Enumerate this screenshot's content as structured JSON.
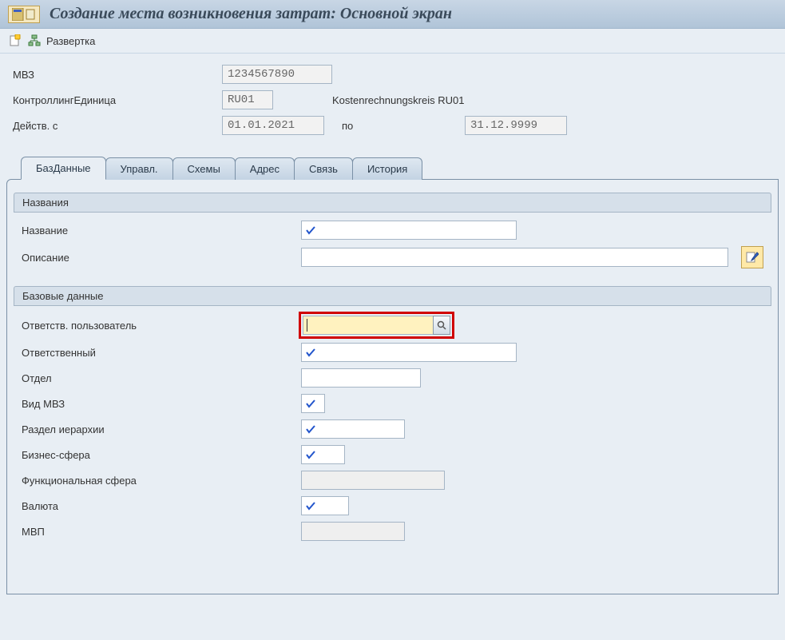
{
  "title": "Создание места возникновения затрат: Основной экран",
  "toolbar": {
    "expand_label": "Развертка"
  },
  "header": {
    "mvz_label": "МВЗ",
    "mvz_value": "1234567890",
    "cokrs_label": "КонтроллингЕдиница",
    "cokrs_value": "RU01",
    "cokrs_desc": "Kostenrechnungskreis RU01",
    "valid_from_label": "Действ. с",
    "valid_from_value": "01.01.2021",
    "valid_to_label": "по",
    "valid_to_value": "31.12.9999"
  },
  "tabs": [
    {
      "id": "basic",
      "label": "БазДанные",
      "active": true
    },
    {
      "id": "control",
      "label": "Управл.",
      "active": false
    },
    {
      "id": "schemes",
      "label": "Схемы",
      "active": false
    },
    {
      "id": "address",
      "label": "Адрес",
      "active": false
    },
    {
      "id": "comm",
      "label": "Связь",
      "active": false
    },
    {
      "id": "history",
      "label": "История",
      "active": false
    }
  ],
  "groups": {
    "names": {
      "title": "Названия",
      "name_label": "Название",
      "desc_label": "Описание"
    },
    "basic": {
      "title": "Базовые данные",
      "resp_user_label": "Ответств. пользователь",
      "responsible_label": "Ответственный",
      "department_label": "Отдел",
      "cctype_label": "Вид МВЗ",
      "hierarchy_label": "Раздел иерархии",
      "busarea_label": "Бизнес-сфера",
      "funcarea_label": "Функциональная сфера",
      "currency_label": "Валюта",
      "mvp_label": "МВП"
    }
  }
}
